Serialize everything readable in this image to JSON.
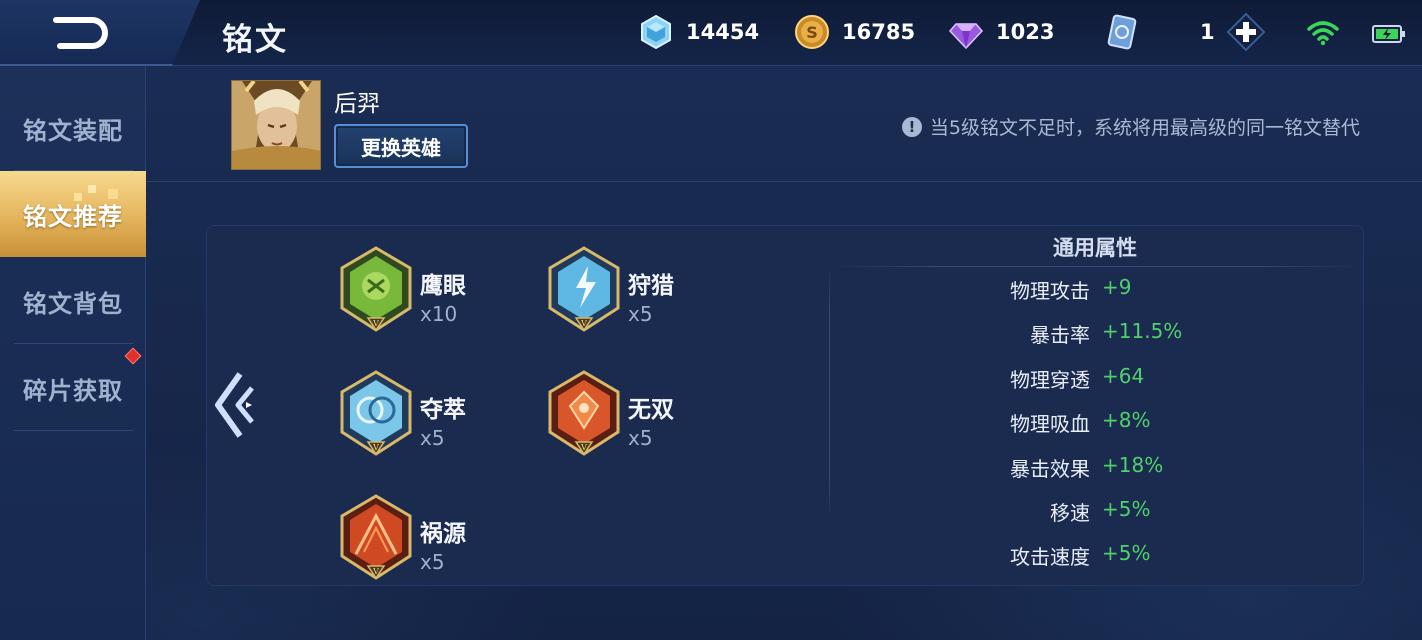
{
  "header": {
    "title": "铭文",
    "currencies": [
      {
        "name": "diamond-coupon",
        "value": "14454"
      },
      {
        "name": "gold",
        "value": "16785"
      },
      {
        "name": "gem",
        "value": "1023"
      },
      {
        "name": "card",
        "value": "1"
      }
    ]
  },
  "sidebar": {
    "items": [
      {
        "label": "铭文装配"
      },
      {
        "label": "铭文推荐",
        "active": true
      },
      {
        "label": "铭文背包"
      },
      {
        "label": "碎片获取"
      }
    ]
  },
  "hero": {
    "name": "后羿",
    "change_button": "更换英雄"
  },
  "notice": {
    "icon": "!",
    "text": "当5级铭文不足时，系统将用最高级的同一铭文替代"
  },
  "runes": [
    {
      "name": "鹰眼",
      "count": "x10",
      "color": "green"
    },
    {
      "name": "狩猎",
      "count": "x5",
      "color": "blue"
    },
    {
      "name": "夺萃",
      "count": "x5",
      "color": "blue"
    },
    {
      "name": "无双",
      "count": "x5",
      "color": "red"
    },
    {
      "name": "祸源",
      "count": "x5",
      "color": "red"
    }
  ],
  "attributes": {
    "title": "通用属性",
    "rows": [
      {
        "key": "物理攻击",
        "value": "+9"
      },
      {
        "key": "暴击率",
        "value": "+11.5%"
      },
      {
        "key": "物理穿透",
        "value": "+64"
      },
      {
        "key": "物理吸血",
        "value": "+8%"
      },
      {
        "key": "暴击效果",
        "value": "+18%"
      },
      {
        "key": "移速",
        "value": "+5%"
      },
      {
        "key": "攻击速度",
        "value": "+5%"
      }
    ]
  },
  "colors": {
    "accent_gold": "#e4b45b",
    "value_green": "#4fd06a",
    "panel": "#1a2b4f"
  }
}
